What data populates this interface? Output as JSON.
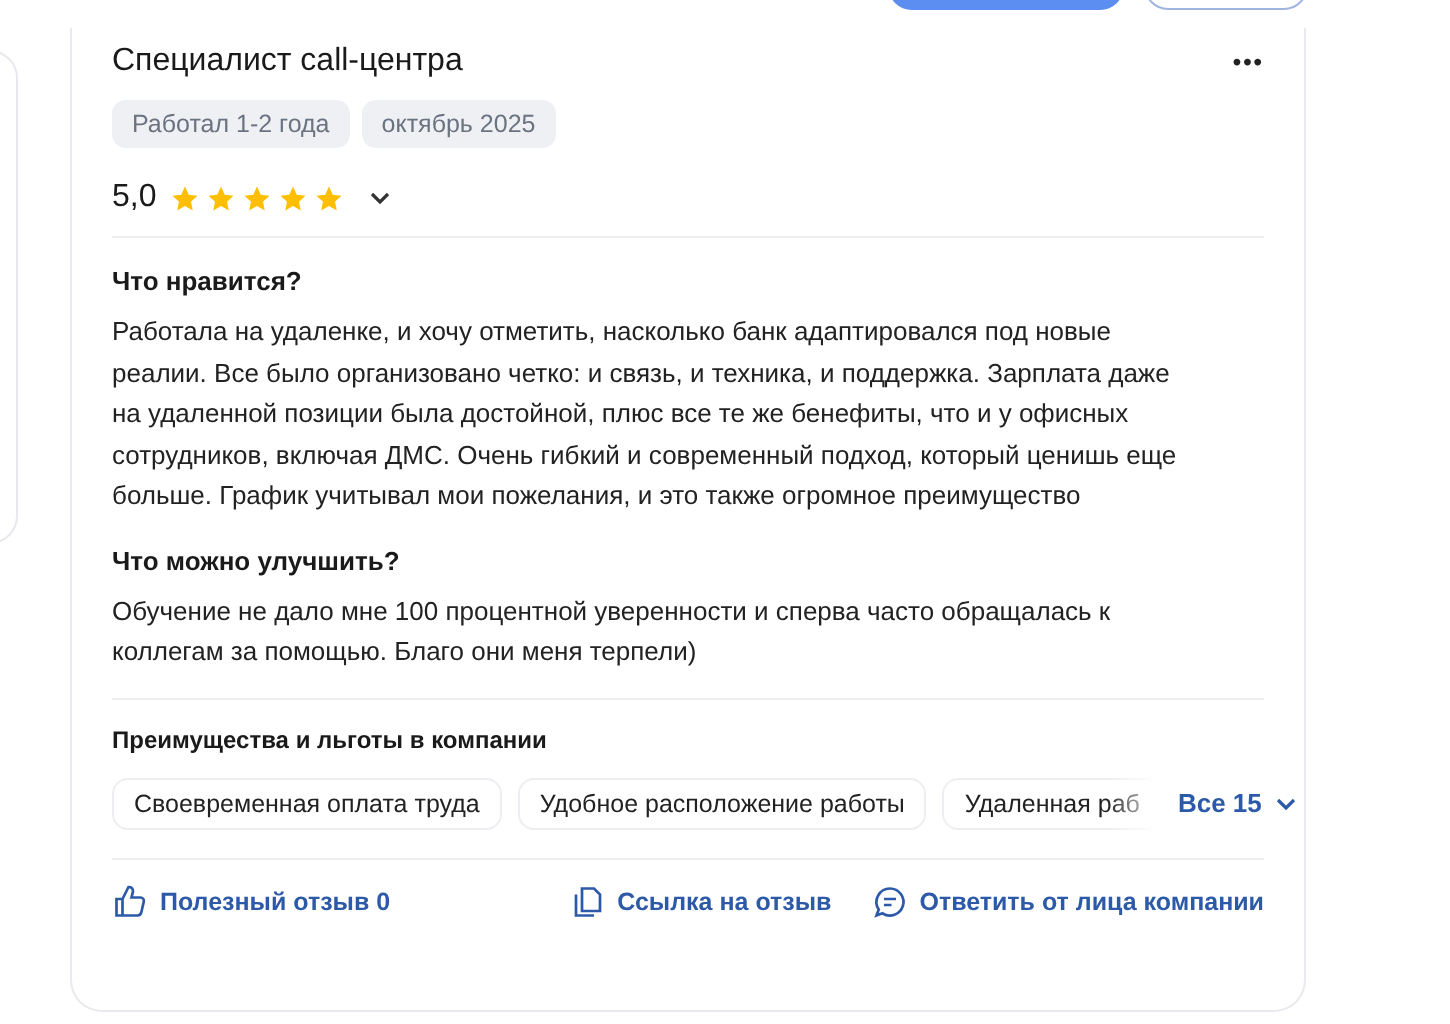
{
  "review": {
    "title": "Специалист call-центра",
    "menu_icon": "•••",
    "tags": [
      "Работал 1-2 года",
      "октябрь 2025"
    ],
    "rating": {
      "value": "5,0",
      "stars": 5
    },
    "sections": [
      {
        "heading": "Что нравится?",
        "text": "Работала на удаленке, и хочу отметить, насколько банк адаптировался под новые реалии. Все было организовано четко: и связь, и техника, и поддержка. Зарплата даже на удаленной позиции была достойной, плюс все те же бенефиты, что и у офисных сотрудников, включая ДМС. Очень гибкий и современный подход, который ценишь еще больше. График учитывал мои пожелания, и это также огромное преимущество"
      },
      {
        "heading": "Что можно улучшить?",
        "text": "Обучение не дало мне 100 процентной уверенности и сперва часто обращалась к коллегам за помощью. Благо они меня терпели)"
      }
    ],
    "benefits": {
      "heading": "Преимущества и льготы в компании",
      "items": [
        "Своевременная оплата труда",
        "Удобное расположение работы",
        "Удаленная раб"
      ],
      "more": "Все 15"
    },
    "actions": [
      {
        "kind": "like",
        "label": "Полезный отзыв 0"
      },
      {
        "kind": "link",
        "label": "Ссылка на отзыв"
      },
      {
        "kind": "reply",
        "label": "Ответить от лица компании"
      }
    ]
  }
}
